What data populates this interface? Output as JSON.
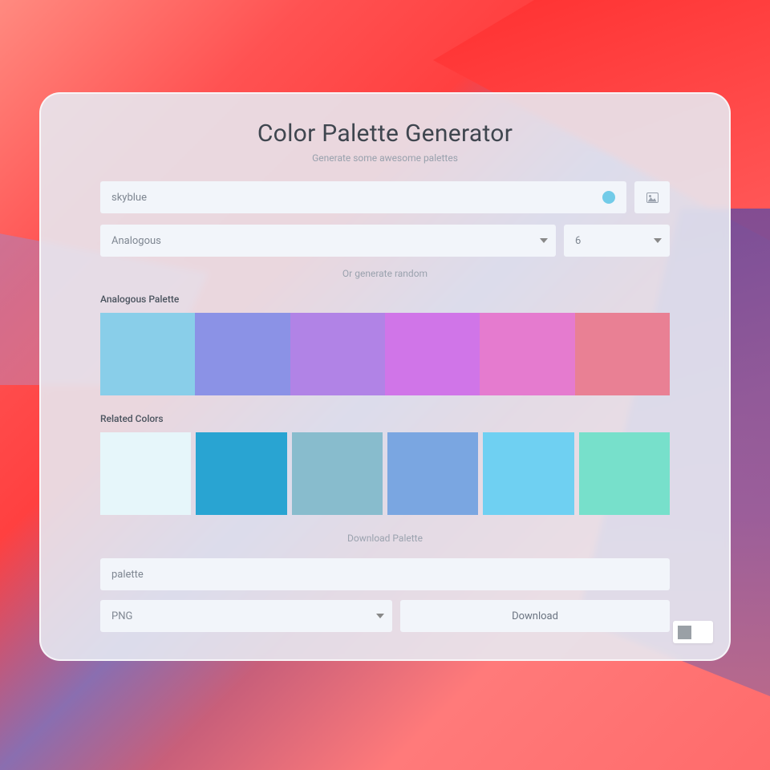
{
  "header": {
    "title": "Color Palette Generator",
    "subtitle": "Generate some awesome palettes"
  },
  "color_input": {
    "value": "skyblue",
    "swatch_color": "#72cbe8"
  },
  "scheme_select": {
    "value": "Analogous"
  },
  "count_select": {
    "value": "6"
  },
  "random_link": "Or generate random",
  "palette_label": "Analogous Palette",
  "palette_colors": [
    "#89cee9",
    "#8b92e6",
    "#b183e6",
    "#d075e8",
    "#e57bcf",
    "#e98094"
  ],
  "related_label": "Related Colors",
  "related_colors": [
    "#e6f6fa",
    "#29a4d2",
    "#88bccd",
    "#7aa6e1",
    "#6fd0f2",
    "#77e0cb"
  ],
  "download": {
    "heading": "Download Palette",
    "filename": "palette",
    "format": "PNG",
    "button": "Download"
  }
}
